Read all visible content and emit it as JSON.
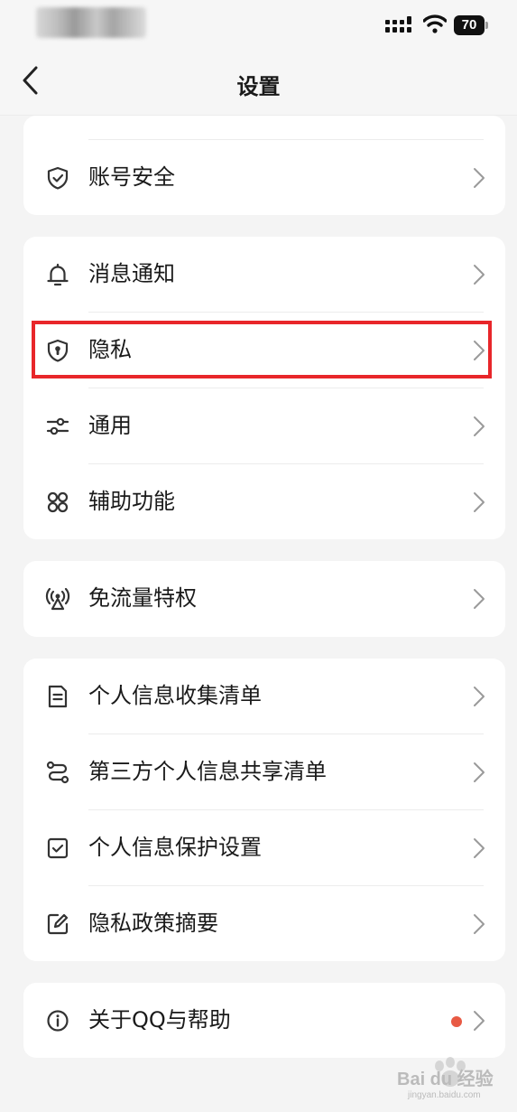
{
  "status_bar": {
    "battery": "70"
  },
  "nav": {
    "title": "设置"
  },
  "groups": [
    {
      "items": [
        {
          "label": "账号安全",
          "icon": "shield-check-icon"
        }
      ]
    },
    {
      "items": [
        {
          "label": "消息通知",
          "icon": "bell-icon"
        },
        {
          "label": "隐私",
          "icon": "shield-lock-icon"
        },
        {
          "label": "通用",
          "icon": "sliders-icon"
        },
        {
          "label": "辅助功能",
          "icon": "grid-icon"
        }
      ]
    },
    {
      "items": [
        {
          "label": "免流量特权",
          "icon": "antenna-icon"
        }
      ]
    },
    {
      "items": [
        {
          "label": "个人信息收集清单",
          "icon": "document-icon"
        },
        {
          "label": "第三方个人信息共享清单",
          "icon": "share-route-icon"
        },
        {
          "label": "个人信息保护设置",
          "icon": "checkbox-icon"
        },
        {
          "label": "隐私政策摘要",
          "icon": "edit-icon"
        }
      ]
    },
    {
      "items": [
        {
          "label": "关于QQ与帮助",
          "icon": "info-icon",
          "badge": "red-dot"
        }
      ]
    }
  ],
  "colors": {
    "background": "#f4f4f4",
    "card": "#ffffff",
    "highlight": "#e8262a",
    "badge": "#e85a44"
  },
  "watermark": {
    "brand": "Bai du 经验",
    "url": "jingyan.baidu.com"
  }
}
